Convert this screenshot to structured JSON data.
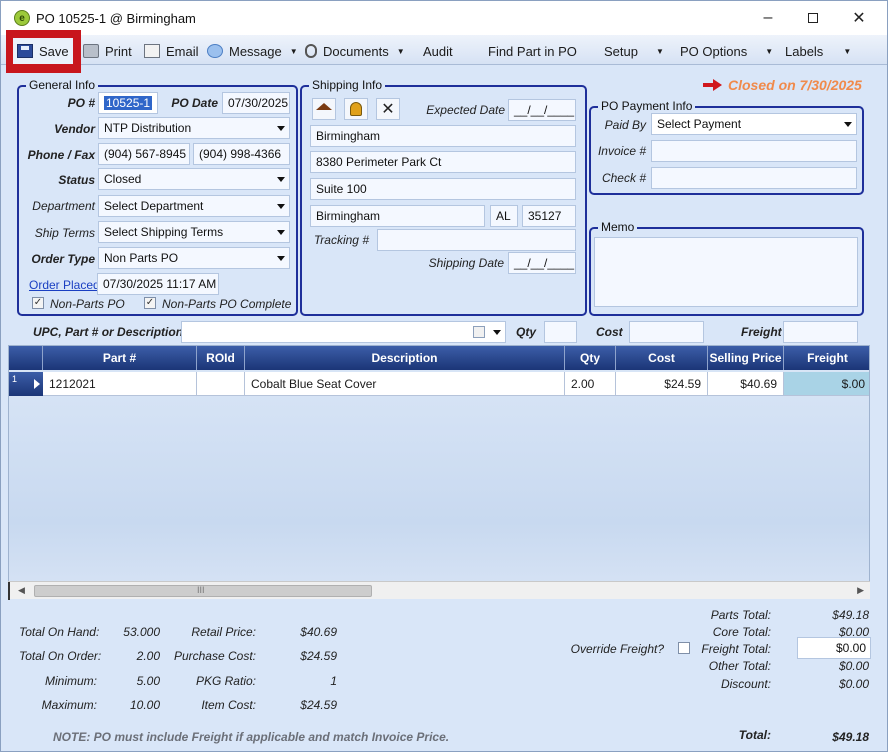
{
  "window": {
    "title": "PO 10525-1 @ Birmingham"
  },
  "toolbar": {
    "save": "Save",
    "print": "Print",
    "email": "Email",
    "message": "Message",
    "documents": "Documents",
    "audit": "Audit",
    "find_part": "Find Part in PO",
    "setup": "Setup",
    "po_options": "PO Options",
    "labels": "Labels"
  },
  "status_banner": "Closed on 7/30/2025",
  "general_info": {
    "title": "General Info",
    "po_label": "PO #",
    "po_value": "10525-1",
    "po_date_label": "PO Date",
    "po_date_value": "07/30/2025",
    "vendor_label": "Vendor",
    "vendor_value": "NTP Distribution",
    "phone_label": "Phone / Fax",
    "phone_value": "(904) 567-8945",
    "fax_value": "(904) 998-4366",
    "status_label": "Status",
    "status_value": "Closed",
    "department_label": "Department",
    "department_value": "Select Department",
    "ship_terms_label": "Ship Terms",
    "ship_terms_value": "Select Shipping Terms",
    "order_type_label": "Order Type",
    "order_type_value": "Non Parts PO",
    "order_placed_label": "Order Placed",
    "order_placed_value": "07/30/2025 11:17 AM",
    "non_parts_po_label": "Non-Parts PO",
    "non_parts_complete_label": "Non-Parts PO Complete"
  },
  "shipping_info": {
    "title": "Shipping Info",
    "expected_date_label": "Expected Date",
    "expected_date_value": "__/__/____",
    "name": "Birmingham",
    "address1": "8380 Perimeter Park Ct",
    "address2": "Suite 100",
    "city": "Birmingham",
    "state": "AL",
    "zip": "35127",
    "tracking_label": "Tracking #",
    "tracking_value": "",
    "shipping_date_label": "Shipping Date",
    "shipping_date_value": "__/__/____"
  },
  "payment_info": {
    "title": "PO Payment Info",
    "paid_by_label": "Paid By",
    "paid_by_value": "Select Payment",
    "invoice_label": "Invoice #",
    "invoice_value": "",
    "check_label": "Check #",
    "check_value": ""
  },
  "memo": {
    "title": "Memo",
    "value": ""
  },
  "search_bar": {
    "upc_label": "UPC, Part # or Description",
    "qty_label": "Qty",
    "cost_label": "Cost",
    "freight_label": "Freight"
  },
  "grid": {
    "columns": [
      "Part #",
      "ROId",
      "Description",
      "Qty",
      "Cost",
      "Selling Price",
      "Freight"
    ],
    "rows": [
      {
        "index": "1",
        "part": "1212021",
        "roid": "",
        "description": "Cobalt Blue Seat Cover",
        "qty": "2.00",
        "cost": "$24.59",
        "selling_price": "$40.69",
        "freight": "$.00"
      }
    ],
    "scroll_grip": "III"
  },
  "stats": {
    "total_on_hand_label": "Total On Hand:",
    "total_on_hand": "53.000",
    "total_on_order_label": "Total On Order:",
    "total_on_order": "2.00",
    "minimum_label": "Minimum:",
    "minimum": "5.00",
    "maximum_label": "Maximum:",
    "maximum": "10.00",
    "retail_price_label": "Retail Price:",
    "retail_price": "$40.69",
    "purchase_cost_label": "Purchase Cost:",
    "purchase_cost": "$24.59",
    "pkg_ratio_label": "PKG Ratio:",
    "pkg_ratio": "1",
    "item_cost_label": "Item Cost:",
    "item_cost": "$24.59"
  },
  "totals": {
    "override_freight_label": "Override Freight?",
    "parts_total_label": "Parts Total:",
    "parts_total": "$49.18",
    "core_total_label": "Core Total:",
    "core_total": "$0.00",
    "freight_total_label": "Freight Total:",
    "freight_total": "$0.00",
    "other_total_label": "Other Total:",
    "other_total": "$0.00",
    "discount_label": "Discount:",
    "discount": "$0.00",
    "total_label": "Total:",
    "total": "$49.18"
  },
  "note": "NOTE: PO must include Freight if applicable and match Invoice Price.",
  "colors": {
    "accent": "#1e2f9a",
    "closed": "#f08a4b",
    "highlight": "#c8161d"
  }
}
